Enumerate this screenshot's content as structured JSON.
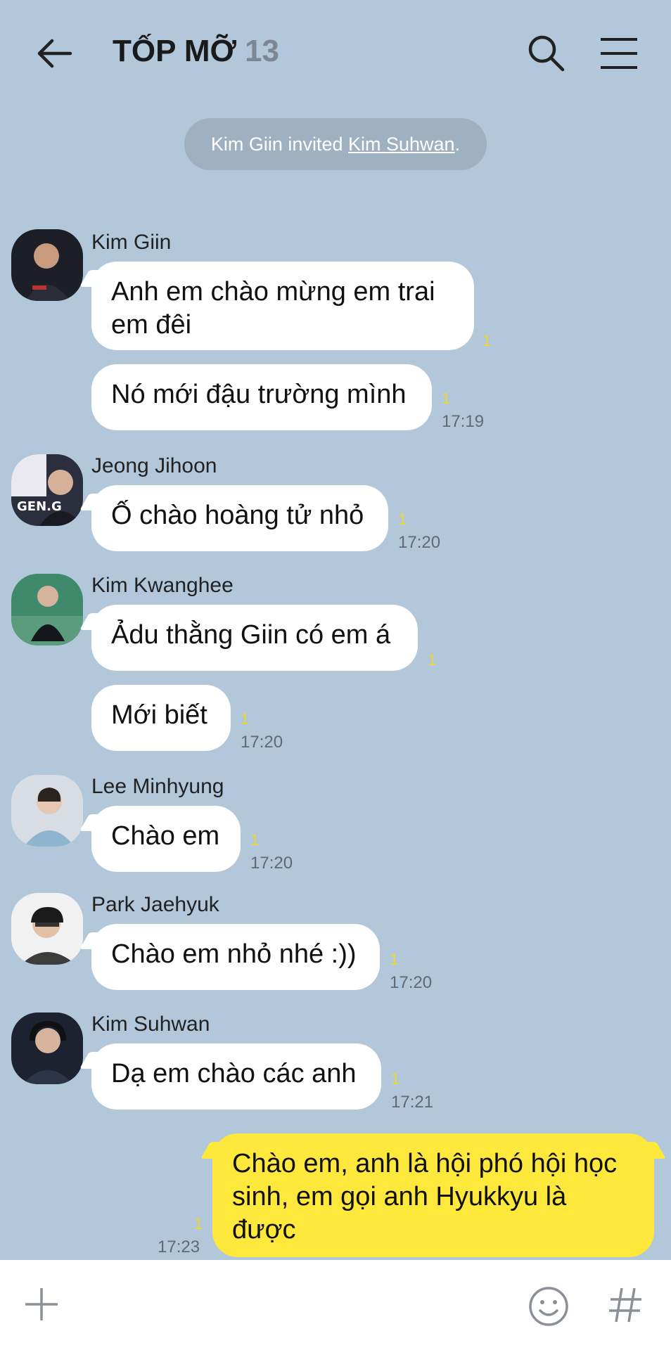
{
  "header": {
    "title": "TỐP MỠ",
    "member_count": "13",
    "back_icon": "arrow-left-icon",
    "search_icon": "search-icon",
    "menu_icon": "hamburger-menu-icon"
  },
  "notice": {
    "inviter": "Kim Giin",
    "text": " invited ",
    "invitee": "Kim Suhwan",
    "end": "."
  },
  "messages": [
    {
      "sender": "Kim Giin",
      "text": "Anh em chào mừng em trai em đêi",
      "unread": "1"
    },
    {
      "sender": "Kim Giin",
      "text": "Nó mới đậu trường mình",
      "unread": "1",
      "time": "17:19"
    },
    {
      "sender": "Jeong Jihoon",
      "text": "Ố chào hoàng tử nhỏ",
      "unread": "1",
      "time": "17:20"
    },
    {
      "sender": "Kim Kwanghee",
      "text": "Ảdu thằng Giin có em á",
      "unread": "1"
    },
    {
      "sender": "Kim Kwanghee",
      "text": "Mới biết",
      "unread": "1",
      "time": "17:20"
    },
    {
      "sender": "Lee Minhyung",
      "text": "Chào em",
      "unread": "1",
      "time": "17:20"
    },
    {
      "sender": "Park Jaehyuk",
      "text": "Chào em nhỏ nhé :))",
      "unread": "1",
      "time": "17:20"
    },
    {
      "sender": "Kim Suhwan",
      "text": "Dạ em chào các anh",
      "unread": "1",
      "time": "17:21"
    },
    {
      "sender": "me",
      "text": "Chào em, anh là hội phó hội học sinh, em gọi anh Hyukkyu là được",
      "unread": "1",
      "time": "17:23"
    }
  ],
  "input_bar": {
    "plus_icon": "plus-icon",
    "emoji_icon": "emoji-icon",
    "hash_icon": "hash-icon"
  },
  "colors": {
    "background": "#b2c7da",
    "my_bubble": "#fee83b",
    "other_bubble": "#ffffff",
    "unread": "#f0d630"
  }
}
